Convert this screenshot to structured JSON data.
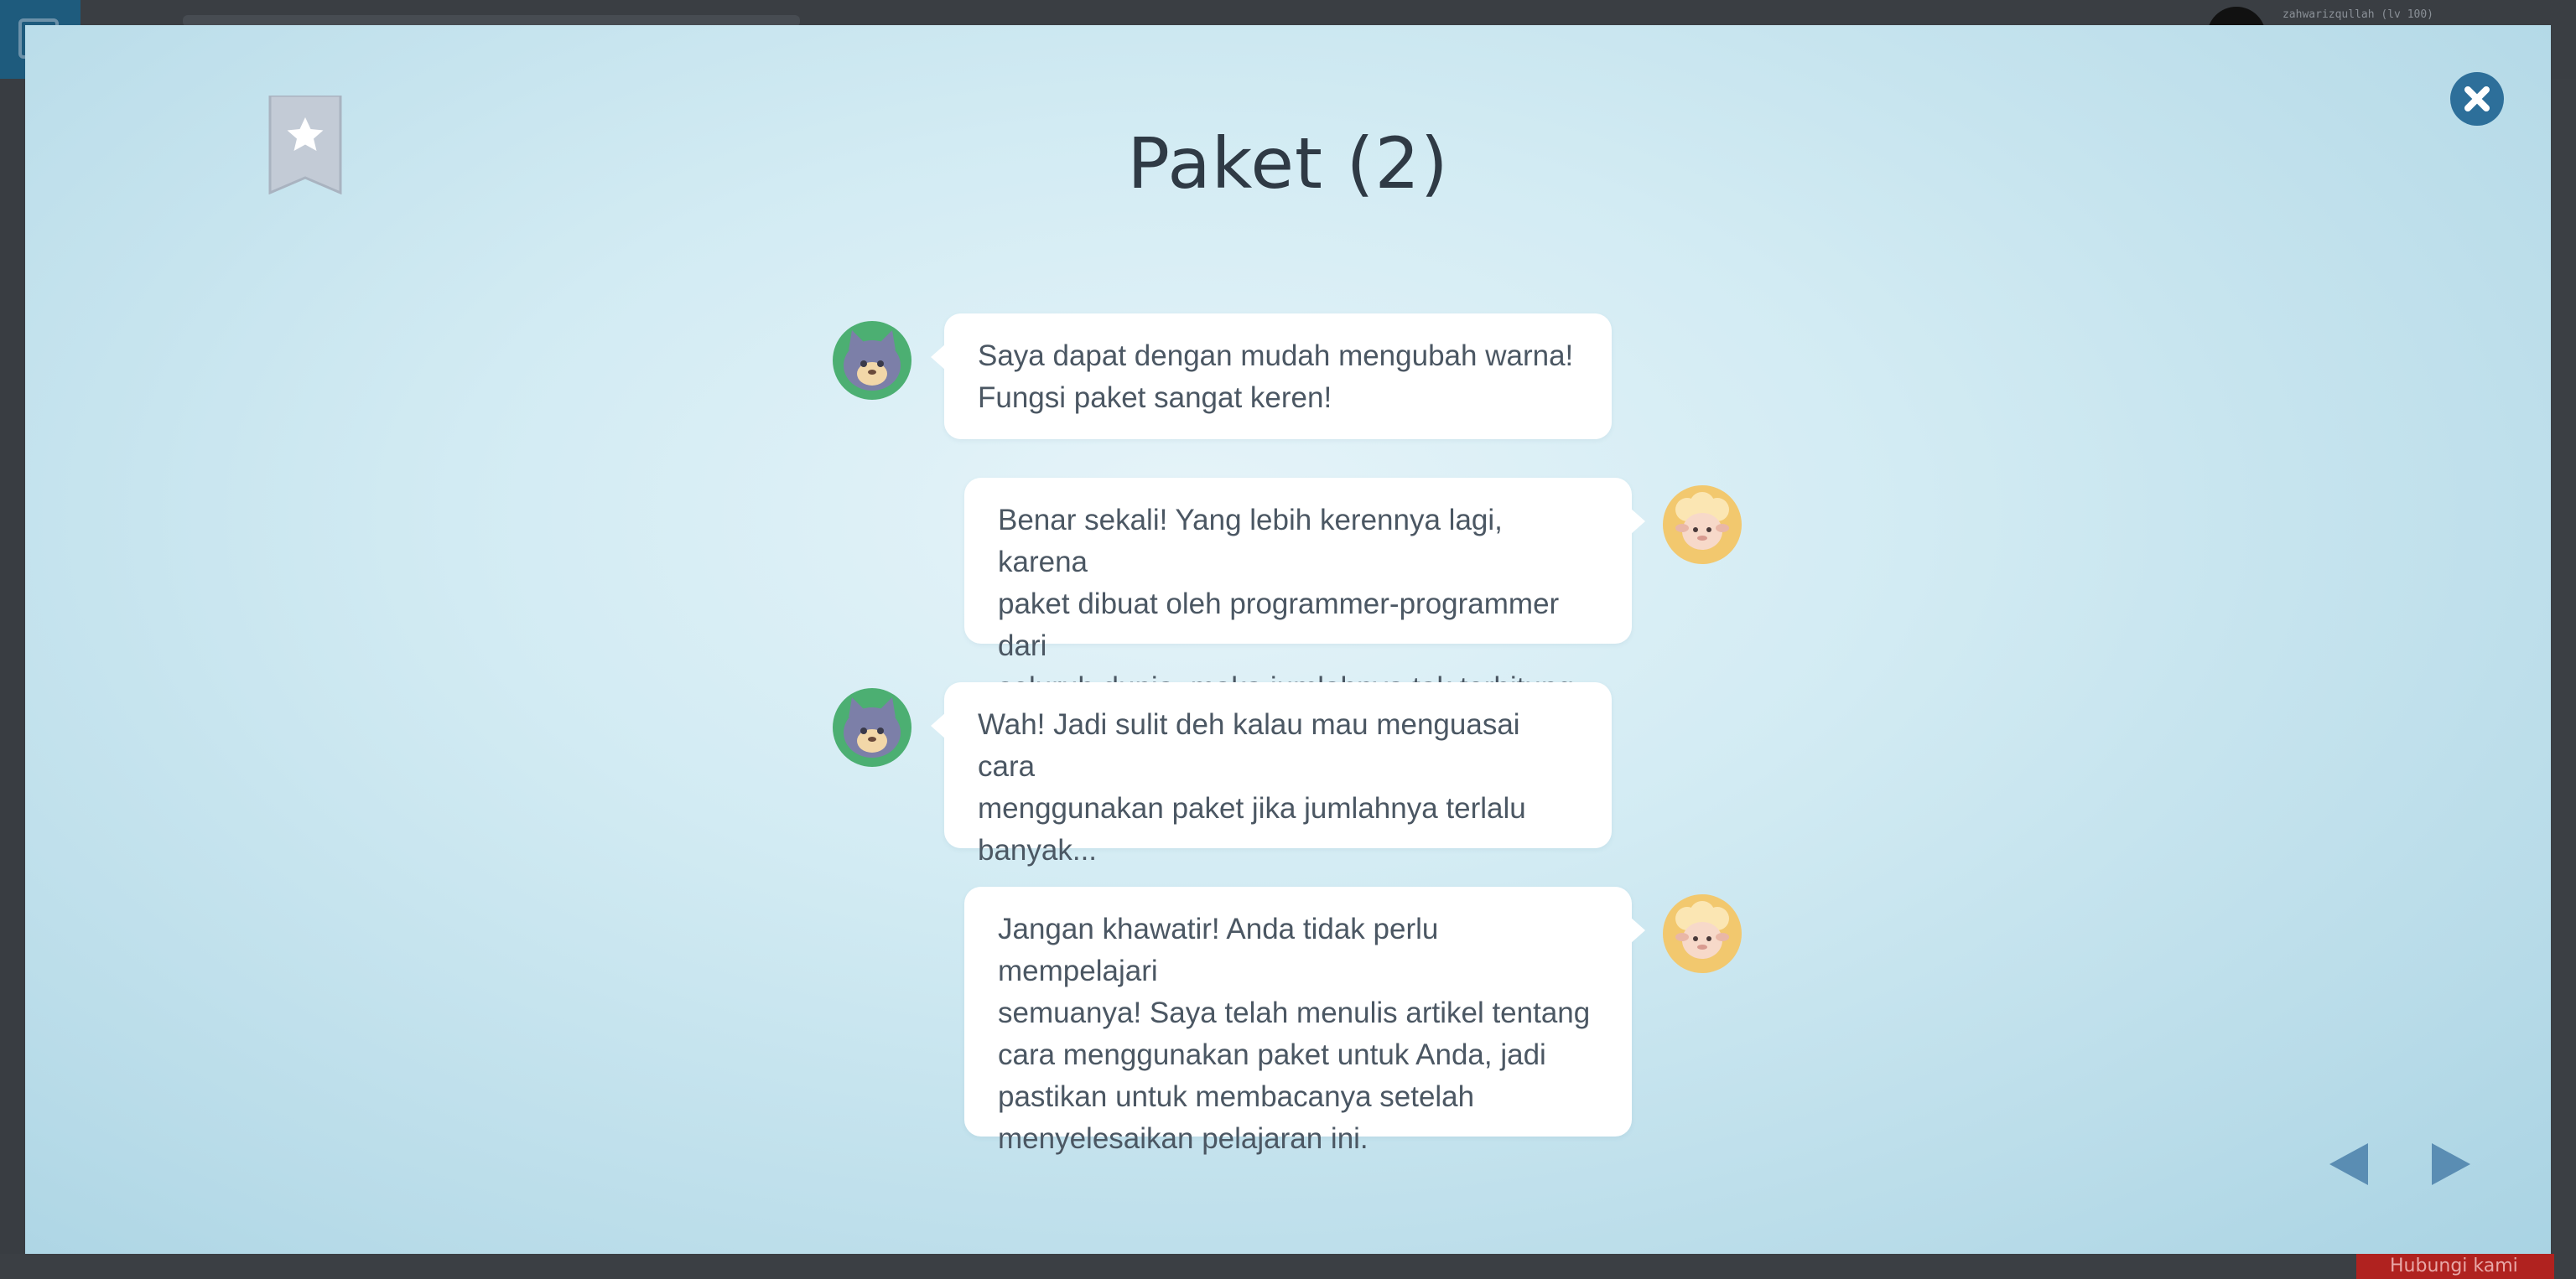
{
  "background": {
    "username": "zahwarizqullah (lv 100)",
    "footer_button_label": "Hubungi kami"
  },
  "modal": {
    "title": "Paket (2)",
    "bookmark_icon": "star-bookmark-icon",
    "close_icon": "close-icon",
    "nav": {
      "prev_icon": "triangle-left-icon",
      "next_icon": "triangle-right-icon"
    },
    "messages": [
      {
        "speaker": "cat",
        "side": "left",
        "lines": [
          "Saya dapat dengan mudah mengubah warna!",
          "Fungsi paket  sangat keren!"
        ]
      },
      {
        "speaker": "sheep",
        "side": "right",
        "lines": [
          "Benar sekali! Yang lebih kerennya lagi, karena",
          "paket dibuat oleh programmer-programmer dari",
          "seluruh dunia, maka jumlahnya tak terhitung."
        ]
      },
      {
        "speaker": "cat",
        "side": "left",
        "lines": [
          "Wah! Jadi sulit deh kalau mau menguasai cara",
          "menggunakan paket jika jumlahnya terlalu",
          "banyak..."
        ]
      },
      {
        "speaker": "sheep",
        "side": "right",
        "lines": [
          "Jangan khawatir! Anda tidak perlu mempelajari",
          "semuanya! Saya telah menulis artikel tentang",
          "cara menggunakan paket untuk Anda, jadi",
          "pastikan untuk membacanya setelah",
          "menyelesaikan pelajaran ini."
        ]
      }
    ]
  },
  "colors": {
    "accent": "#2d6f9a",
    "nav_arrow": "#5a8db3",
    "bubble": "#ffffff",
    "text": "#4b5763"
  }
}
